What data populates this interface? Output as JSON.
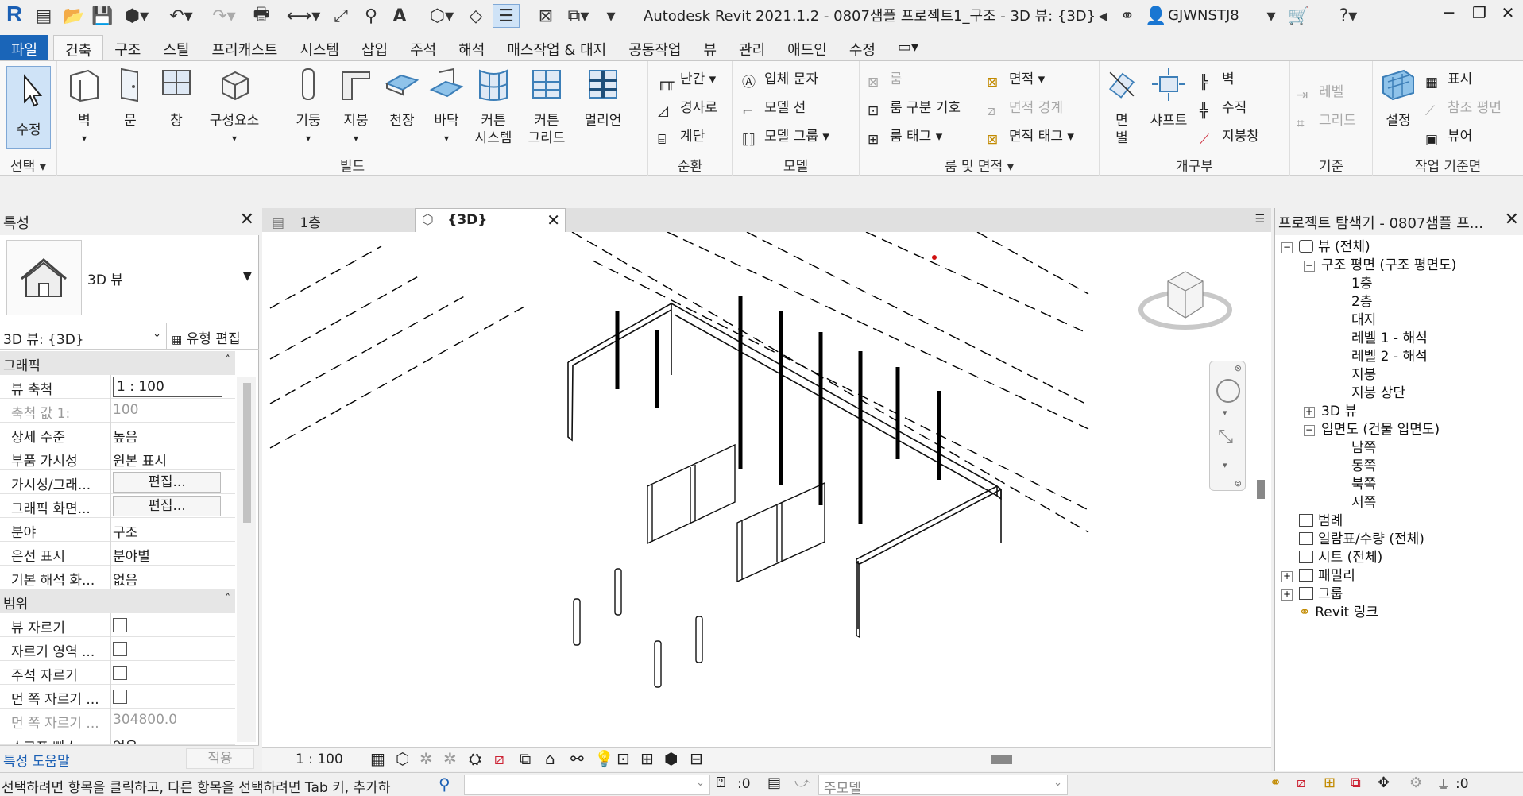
{
  "app": {
    "title": "Autodesk Revit 2021.1.2 - 0807샘플 프로젝트1_구조 - 3D 뷰: {3D}",
    "user": "GJWNSTJ8"
  },
  "tabs": [
    "파일",
    "건축",
    "구조",
    "스틸",
    "프리캐스트",
    "시스템",
    "삽입",
    "주석",
    "해석",
    "매스작업 & 대지",
    "공동작업",
    "뷰",
    "관리",
    "애드인",
    "수정"
  ],
  "active_tab": "건축",
  "ribbon": {
    "select": {
      "button": "수정",
      "group": "선택 ▾"
    },
    "build": {
      "group": "빌드",
      "wall": "벽",
      "door": "문",
      "window": "창",
      "component": "구성요소",
      "column": "기둥",
      "roof": "지붕",
      "ceiling": "천장",
      "floor": "바닥",
      "curtain_system": [
        "커튼",
        "시스템"
      ],
      "curtain_grid": [
        "커튼",
        "그리드"
      ],
      "mullion": "멀리언"
    },
    "circulation": {
      "group": "순환",
      "railing": "난간",
      "ramp": "경사로",
      "stair": "계단"
    },
    "model": {
      "group": "모델",
      "text": "입체 문자",
      "line": "모델 선",
      "group_btn": "모델 그룹"
    },
    "room": {
      "group": "룸 및 면적 ▾",
      "room": "룸",
      "separator": "룸 구분 기호",
      "tag": "룸 태그",
      "area": "면적",
      "boundary": "면적 경계",
      "area_tag": "면적 태그"
    },
    "opening": {
      "group": "개구부",
      "face": [
        "면",
        "별"
      ],
      "shaft": "샤프트",
      "wall": "벽",
      "vertical": "수직",
      "dormer": "지붕창"
    },
    "datum": {
      "group": "기준",
      "level": "레벨",
      "grid": "그리드"
    },
    "workplane": {
      "group": "작업 기준면",
      "set": "설정",
      "show": "표시",
      "ref_plane": "참조 평면",
      "viewer": "뷰어"
    }
  },
  "properties": {
    "title": "특성",
    "type_name": "3D 뷰",
    "selector": "3D 뷰: {3D}",
    "edit_type": "유형 편집",
    "sections": [
      {
        "label": "그래픽"
      },
      {
        "label": "범위"
      }
    ],
    "rows": [
      {
        "k": "뷰 축척",
        "v": "1 : 100"
      },
      {
        "k": "축척 값    1:",
        "v": "100"
      },
      {
        "k": "상세 수준",
        "v": "높음"
      },
      {
        "k": "부품 가시성",
        "v": "원본 표시"
      },
      {
        "k": "가시성/그래...",
        "v": "편집..."
      },
      {
        "k": "그래픽 화면...",
        "v": "편집..."
      },
      {
        "k": "분야",
        "v": "구조"
      },
      {
        "k": "은선 표시",
        "v": "분야별"
      },
      {
        "k": "기본 해석 화...",
        "v": "없음"
      },
      {
        "k": "뷰 자르기",
        "v": ""
      },
      {
        "k": "자르기 영역 ...",
        "v": ""
      },
      {
        "k": "주석 자르기",
        "v": ""
      },
      {
        "k": "먼 쪽 자르기 ...",
        "v": ""
      },
      {
        "k": "먼 쪽 자르기 ...",
        "v": "304800.0"
      },
      {
        "k": "소그프 빠스",
        "v": "없음"
      }
    ],
    "help": "특성 도움말",
    "apply": "적용"
  },
  "view_tabs": [
    "1층",
    "{3D}"
  ],
  "view_scale": "1 : 100",
  "browser": {
    "title": "프로젝트 탐색기 - 0807샘플 프...",
    "items": [
      "뷰 (전체)",
      "구조 평면 (구조 평면도)",
      "1층",
      "2층",
      "대지",
      "레벨 1 - 해석",
      "레벨 2 - 해석",
      "지붕",
      "지붕 상단",
      "3D 뷰",
      "입면도 (건물 입면도)",
      "남쪽",
      "동쪽",
      "북쪽",
      "서쪽",
      "범례",
      "일람표/수량 (전체)",
      "시트 (전체)",
      "패밀리",
      "그룹",
      "Revit 링크"
    ]
  },
  "status": {
    "message": "선택하려면 항목을 클릭하고, 다른 항목을 선택하려면 Tab 키, 추가하",
    "count": ":0",
    "model": "주모델",
    "filter_count": ":0"
  },
  "colors": {
    "file_tab": "#1a65b8",
    "accent": "#1a5fb4"
  }
}
